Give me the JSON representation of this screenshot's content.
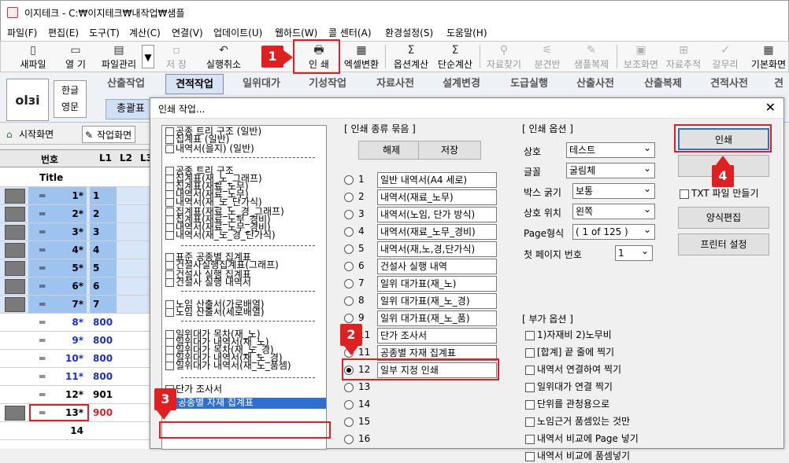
{
  "window": {
    "title": "이지테크 - C:₩이지테크₩내작업₩샘플"
  },
  "menu": [
    "파일(F)",
    "편집(E)",
    "도구(T)",
    "계산(C)",
    "연결(V)",
    "업데이트(U)",
    "웹하드(W)",
    "콜 센터(A)",
    "환경설정(S)",
    "도움말(H)"
  ],
  "toolbar": {
    "new_file": "새파일",
    "open": "열 기",
    "file_manage": "파일관리",
    "save": "저 장",
    "undo": "실행취소",
    "print": "인 쇄",
    "excel": "엑셀변환",
    "opt_calc": "옵션계산",
    "simple_calc": "단순계산",
    "find_data": "자료찾기",
    "split": "분견반",
    "sample_copy": "샘플복제",
    "aux_view": "보조화면",
    "data_trace": "자료추적",
    "finish": "갈무리",
    "basic_view": "기본화면"
  },
  "logo": "olзi",
  "lang": {
    "kor": "한글",
    "eng": "영문"
  },
  "main_tabs": [
    "산출작업",
    "견적작업",
    "일위대가",
    "기성작업",
    "자료사전",
    "설계변경",
    "도급실행",
    "산출사전",
    "산출복제",
    "견적사전",
    "견"
  ],
  "sub_tab": "총괄표",
  "home": {
    "start": "시작화면",
    "work": "작업화면"
  },
  "grid": {
    "headers": [
      "번호",
      "L1",
      "L2",
      "L3"
    ],
    "title_row": "Title",
    "rows": [
      {
        "n": "1*",
        "l1": "1"
      },
      {
        "n": "2*",
        "l1": "2"
      },
      {
        "n": "3*",
        "l1": "3"
      },
      {
        "n": "4*",
        "l1": "4"
      },
      {
        "n": "5*",
        "l1": "5"
      },
      {
        "n": "6*",
        "l1": "6"
      },
      {
        "n": "7*",
        "l1": "7"
      },
      {
        "n": "8*",
        "l1": "800"
      },
      {
        "n": "9*",
        "l1": "800"
      },
      {
        "n": "10*",
        "l1": "800"
      },
      {
        "n": "11*",
        "l1": "800"
      },
      {
        "n": "12*",
        "l1": "901"
      },
      {
        "n": "13*",
        "l1": "900"
      },
      {
        "n": "14",
        "l1": ""
      }
    ]
  },
  "dialog": {
    "title": "인쇄 작업...",
    "tree": [
      "공종 트리 구조        (일반)",
      "집계표                    (일반)",
      "내역서(을지)            (일반)",
      "공종 트리 구조",
      "집계표(재_노_그래프)",
      "집계표(재료_노무)",
      "내역서(재료_노무)",
      "내역서(재_노_단가식)",
      "집계표(재료_노_경_그래프)",
      "집계표(재료_노무_경비)",
      "내역서(재료_노무_경비)",
      "내역서(재_노_경_단가식)",
      "표준 공종별 집계표",
      "건설사실행집계표(그래프)",
      "건설사 실행 집계표",
      "건설사 실행 내역서",
      "노임 산출서(가로배열)",
      "노임 산출서(세로배열)",
      "일위대가 목차(재_노)",
      "일위대가 내역서(재_노)",
      "일위대가 목차(재_노_경)",
      "일위대가 내역서(재_노_경)",
      "일위대가 내역서(재_노_품셈)",
      "단가 조사서",
      "공종별 자재 집계표"
    ],
    "group_label": "[ 인쇄 종류 묶음 ]",
    "release": "해제",
    "save": "저장",
    "print_types": [
      {
        "n": "1",
        "t": "일반 내역서(A4 세로)"
      },
      {
        "n": "2",
        "t": "내역서(재료_노무)"
      },
      {
        "n": "3",
        "t": "내역서(노임, 단가 방식)"
      },
      {
        "n": "4",
        "t": "내역서(재료_노무_경비)"
      },
      {
        "n": "5",
        "t": "내역서(재,노,경,단가식)"
      },
      {
        "n": "6",
        "t": "건설사 실행 내역"
      },
      {
        "n": "7",
        "t": "일위 대가표(재_노)"
      },
      {
        "n": "8",
        "t": "일위 대가표(재_노_경)"
      },
      {
        "n": "9",
        "t": "일위 대가표(재_노_품)"
      },
      {
        "n": "11",
        "t": "단가 조사서"
      },
      {
        "n": "11",
        "t": "공종별 자재 집계표"
      },
      {
        "n": "12",
        "t": "일부 지정 인쇄"
      },
      {
        "n": "13",
        "t": ""
      },
      {
        "n": "14",
        "t": ""
      },
      {
        "n": "15",
        "t": ""
      },
      {
        "n": "16",
        "t": ""
      }
    ],
    "options_label": "[ 인쇄 옵션 ]",
    "opts": {
      "company": "상호",
      "company_v": "테스트",
      "font": "글꼴",
      "font_v": "굴림체",
      "box": "박스 굵기",
      "box_v": "보통",
      "pos": "상호 위치",
      "pos_v": "왼쪽",
      "page": "Page형식",
      "page_v": "( 1 of 125 )",
      "first": "첫 페이지 번호",
      "first_v": "1"
    },
    "extra_label": "[ 부가 옵션 ]",
    "extra": [
      "1)자재비  2)노무비",
      "[합계] 끝 줄에 찍기",
      "내역서 연결하여 찍기",
      "일위대가 연결 찍기",
      "단위를 관청용으로",
      "노임근거 품셈있는 것만",
      "내역서 비교에 Page 넣기",
      "내역서 비교에 품셈넣기"
    ],
    "btn_print": "인쇄",
    "btn_blank": "",
    "txt_file": "TXT 파일 만들기",
    "form_edit": "양식편집",
    "printer": "프린터 설정"
  },
  "callouts": [
    "1",
    "2",
    "3",
    "4"
  ]
}
